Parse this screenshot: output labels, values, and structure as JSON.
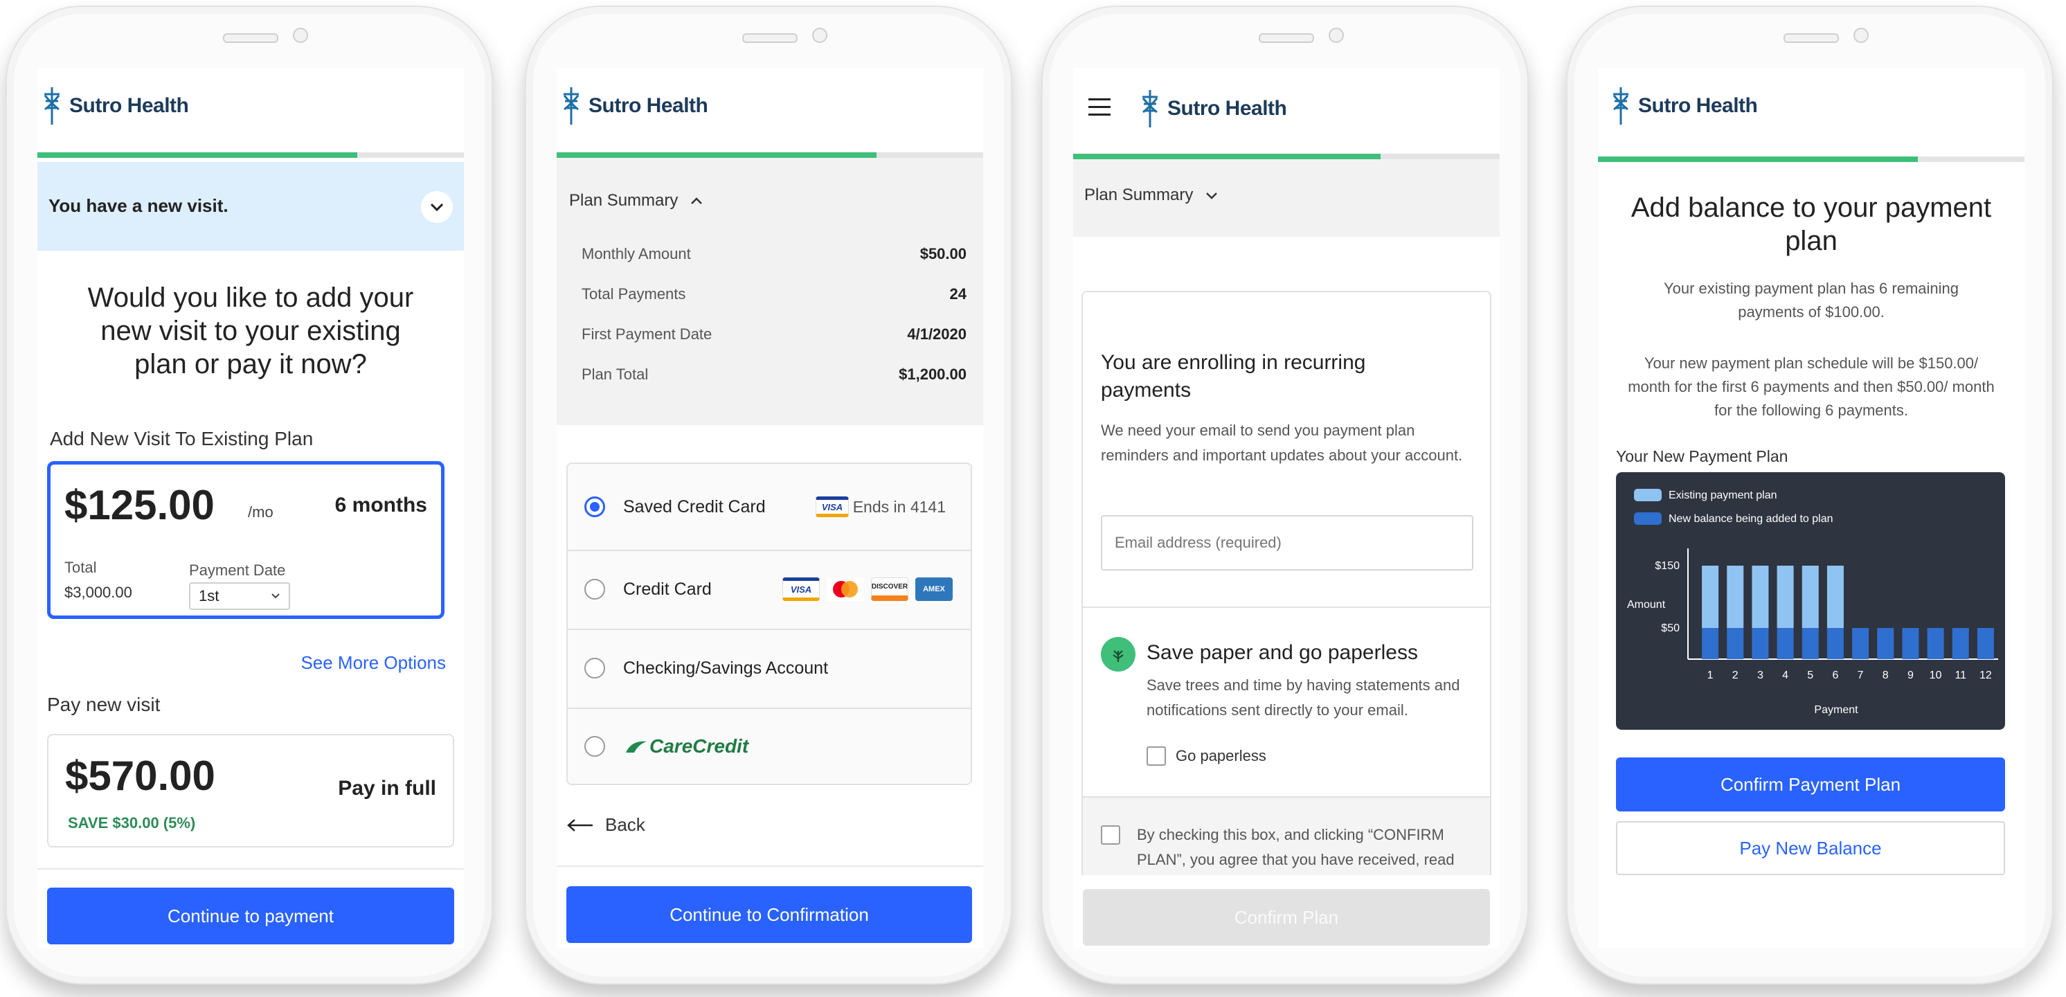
{
  "brand": {
    "name": "Sutro Health"
  },
  "colors": {
    "primary": "#2962ff",
    "progress": "#3fbf7a",
    "alert_bg": "#ddeefd",
    "savings": "#2e8b57"
  },
  "screen1": {
    "alert_text": "You have a new visit.",
    "question": "Would you like to add your new visit to your existing plan or pay it now?",
    "add_heading": "Add New Visit To Existing Plan",
    "plan": {
      "amount": "$125.00",
      "per": "/mo",
      "duration": "6 months",
      "total_label": "Total",
      "total_value": "$3,000.00",
      "date_label": "Payment Date",
      "date_value": "1st"
    },
    "see_more": "See More Options",
    "pay_heading": "Pay new visit",
    "pay": {
      "amount": "$570.00",
      "label": "Pay in full",
      "savings": "SAVE $30.00 (5%)"
    },
    "cta": "Continue to payment",
    "progress": 0.75
  },
  "screen2": {
    "summary_label": "Plan Summary",
    "rows": [
      {
        "label": "Monthly Amount",
        "value": "$50.00"
      },
      {
        "label": "Total Payments",
        "value": "24"
      },
      {
        "label": "First Payment Date",
        "value": "4/1/2020"
      },
      {
        "label": "Plan Total",
        "value": "$1,200.00"
      }
    ],
    "options": {
      "saved": {
        "label": "Saved Credit Card",
        "card": "VISA",
        "ends": "Ends in 4141"
      },
      "credit": {
        "label": "Credit Card",
        "cards": [
          "VISA",
          "MC",
          "DISCOVER",
          "AMEX"
        ]
      },
      "checking": {
        "label": "Checking/Savings Account"
      },
      "carecredit": {
        "label": "CareCredit"
      }
    },
    "back": "Back",
    "cta": "Continue to Confirmation",
    "progress": 0.75
  },
  "screen3": {
    "summary_label": "Plan Summary",
    "enroll_title": "You are enrolling in recurring payments",
    "enroll_desc": "We need your email to send you payment plan reminders and important updates about your account.",
    "email_placeholder": "Email address (required)",
    "paperless_title": "Save paper and go paperless",
    "paperless_desc": "Save trees and time by having statements and notifications sent directly to your email.",
    "paperless_checkbox": "Go paperless",
    "consent": "By checking this box, and clicking “CONFIRM PLAN”, you agree that you have received, read and agree to the Payment",
    "cta": "Confirm Plan",
    "progress": 0.72
  },
  "screen4": {
    "title": "Add  balance to your payment plan",
    "existing_text": "Your existing payment plan has 6 remaining payments of $100.00.",
    "new_text": "Your new payment plan schedule will be $150.00/ month for the first 6 payments and then $50.00/ month for the following 6 payments.",
    "chart_heading": "Your New Payment Plan",
    "confirm": "Confirm Payment Plan",
    "pay_balance": "Pay New Balance",
    "progress": 0.75
  },
  "chart_data": {
    "type": "bar",
    "stacked": true,
    "categories": [
      "1",
      "2",
      "3",
      "4",
      "5",
      "6",
      "7",
      "8",
      "9",
      "10",
      "11",
      "12"
    ],
    "series": [
      {
        "name": "New balance being added to plan",
        "values": [
          50,
          50,
          50,
          50,
          50,
          50,
          50,
          50,
          50,
          50,
          50,
          50
        ],
        "color": "#2f6fd0"
      },
      {
        "name": "Existing payment plan",
        "values": [
          100,
          100,
          100,
          100,
          100,
          100,
          0,
          0,
          0,
          0,
          0,
          0
        ],
        "color": "#8fc3f2"
      }
    ],
    "xlabel": "Payment",
    "ylabel": "Amount",
    "yticks": [
      "$150",
      "$50"
    ],
    "ytick_values": [
      150,
      50
    ],
    "ylim": [
      0,
      160
    ],
    "legend": "top-left",
    "background": "#2e3440"
  }
}
